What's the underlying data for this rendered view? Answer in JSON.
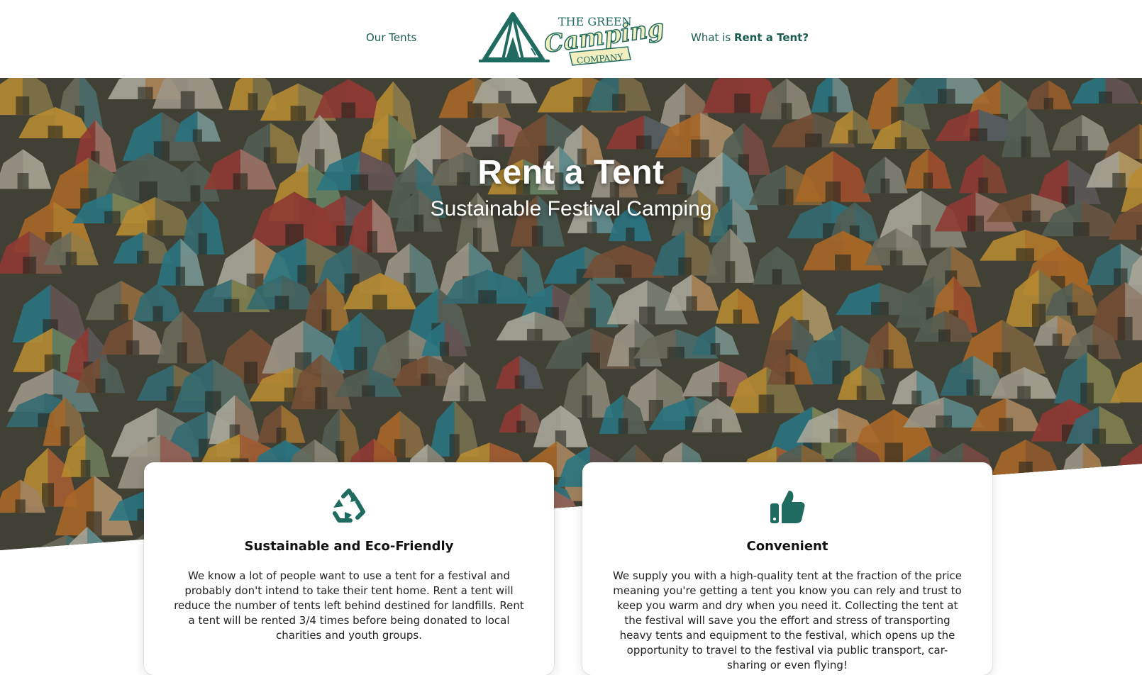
{
  "colors": {
    "brand_green": "#1f6b5f",
    "nav_text": "#1c5c50",
    "logo_cream": "#f2eec0"
  },
  "header": {
    "nav_left": "Our Tents",
    "nav_right_prefix": "What is ",
    "nav_right_bold": "Rent a Tent?",
    "logo": {
      "line1": "THE GREEN",
      "line2": "Camping",
      "line3": "COMPANY",
      "icon": "tent-logo-icon"
    }
  },
  "hero": {
    "title": "Rent a Tent",
    "subtitle": "Sustainable Festival Camping",
    "image": "festival-campsite-photo"
  },
  "cards": [
    {
      "icon": "recycle-icon",
      "title": "Sustainable and Eco-Friendly",
      "text": "We know a lot of people want to use a tent for a festival and probably don't intend to take their tent home. Rent a tent will reduce the number of tents left behind destined for landfills. Rent a tent will be rented 3/4 times before being donated to local charities and youth groups."
    },
    {
      "icon": "thumbs-up-icon",
      "title": "Convenient",
      "text": "We supply you with a high-quality tent at the fraction of the price meaning you're getting a tent you know you can rely and trust to keep you warm and dry when you need it. Collecting the tent at the festival will save you the effort and stress of transporting heavy tents and equipment to the festival, which opens up the opportunity to travel to the festival via public transport, car-sharing or even flying!"
    }
  ]
}
